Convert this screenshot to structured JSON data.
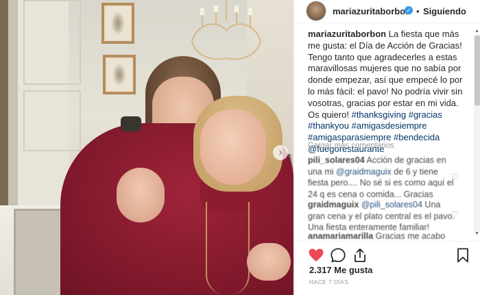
{
  "post": {
    "username": "mariazuritaborbon",
    "follow_label": "Siguiendo",
    "separator": "•",
    "verified_glyph": "✓",
    "verified_color": "#3897f0"
  },
  "caption": {
    "username": "mariazuritaborbon",
    "text": " La fiesta que más me gusta: el Día de Acción de Gracias! Tengo tanto que agradecerles a estas maravillosas mujeres que no sabía por donde empezar, así que empecé lo por lo más fácil: el pavo! No podría vivir sin vosotras, gracias por estar en mi vida. Os quiero! ",
    "hashtags": [
      "#thanksgiving",
      "#gracias",
      "#thankyou",
      "#amigasdesiempre",
      "#amigasparasiempre",
      "#bendecida"
    ],
    "mention": "@fuegorestaurante"
  },
  "load_more_label": "Cargar más comentarios",
  "comments": [
    {
      "username": "pili_solares04",
      "text_before": " Acción de gracias en una mi ",
      "mention": "@graidmaguix",
      "text_after": " de 6 y tiene fiesta pero.... No sé si es como aquí el 24 q es cena o comida... Gracias"
    },
    {
      "username": "graidmaguix",
      "text_before": " ",
      "mention": "@pili_solares04",
      "text_after": " Una gran cena y el plato central es el pavo. Una fiesta enteramente familiar!"
    },
    {
      "username": "anamariamarilla",
      "text_before": " Gracias me acabo de",
      "mention": "",
      "text_after": ""
    }
  ],
  "likes_label": "2.317 Me gusta",
  "time_label": "HACE 7 DÍAS",
  "colors": {
    "like_red": "#ed4956",
    "link_blue": "#003569",
    "muted_gray": "#999999"
  },
  "icons": {
    "like": "heart-icon",
    "comment": "comment-bubble-icon",
    "share": "share-icon",
    "save": "bookmark-icon",
    "next": "chevron-right-icon"
  }
}
